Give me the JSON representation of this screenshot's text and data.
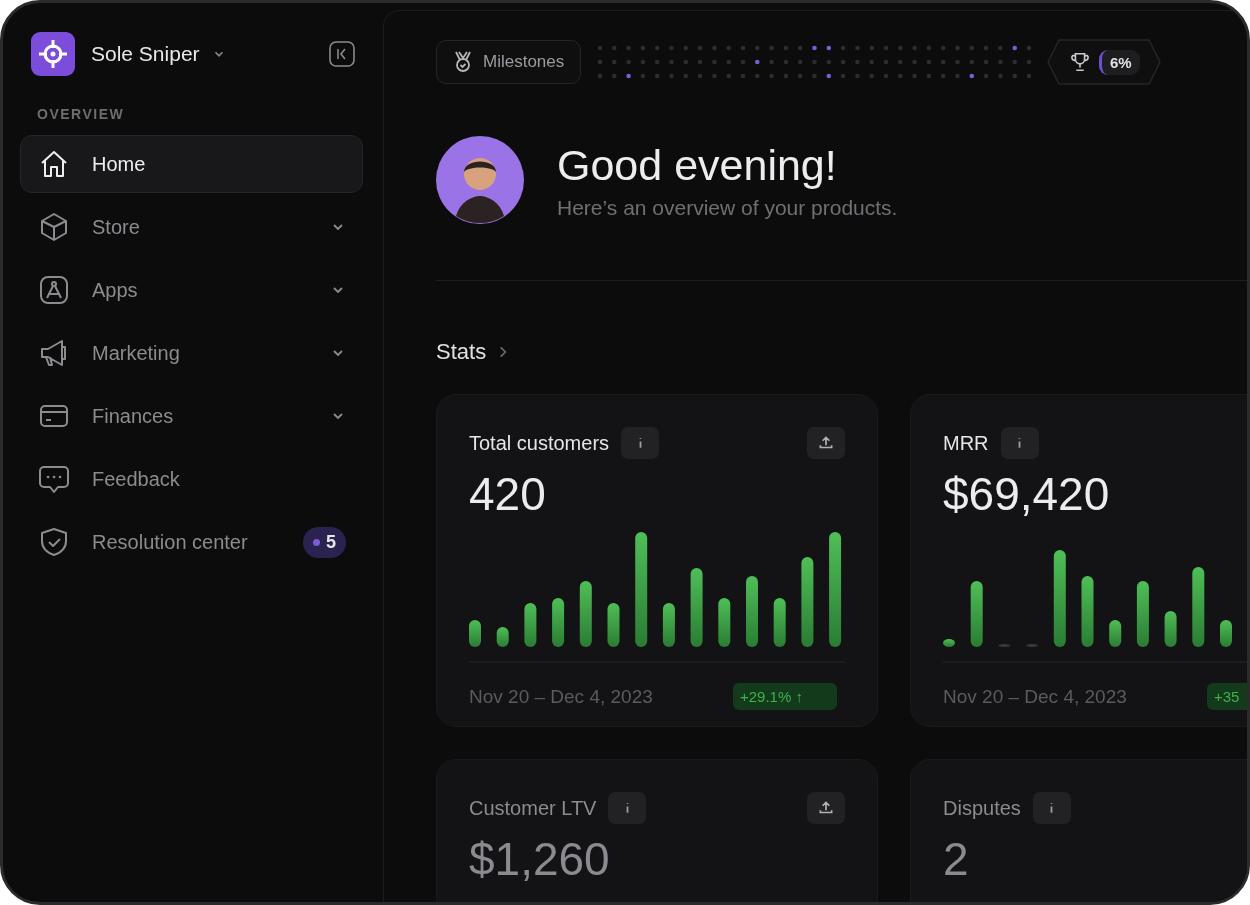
{
  "workspace": {
    "name": "Sole Sniper"
  },
  "sidebar": {
    "section_label": "OVERVIEW",
    "items": [
      {
        "label": "Home",
        "selected": true,
        "expandable": false
      },
      {
        "label": "Store",
        "selected": false,
        "expandable": true
      },
      {
        "label": "Apps",
        "selected": false,
        "expandable": true
      },
      {
        "label": "Marketing",
        "selected": false,
        "expandable": true
      },
      {
        "label": "Finances",
        "selected": false,
        "expandable": true
      },
      {
        "label": "Feedback",
        "selected": false,
        "expandable": false
      },
      {
        "label": "Resolution center",
        "selected": false,
        "expandable": false,
        "badge": "5"
      }
    ]
  },
  "milestones": {
    "label": "Milestones",
    "progress": "6%"
  },
  "greeting": {
    "title": "Good evening!",
    "subtitle": "Here’s an overview of your products."
  },
  "stats": {
    "heading": "Stats",
    "cards": [
      {
        "title": "Total customers",
        "value": "420",
        "export": true,
        "date_range": "Nov 20 – Dec 4, 2023",
        "change": "+29.1% ↑"
      },
      {
        "title": "MRR",
        "value": "$69,420",
        "export": false,
        "date_range": "Nov 20 – Dec 4, 2023",
        "change": "+35"
      },
      {
        "title": "Customer LTV",
        "value": "$1,260",
        "export": true
      },
      {
        "title": "Disputes",
        "value": "2",
        "export": false
      }
    ]
  }
}
